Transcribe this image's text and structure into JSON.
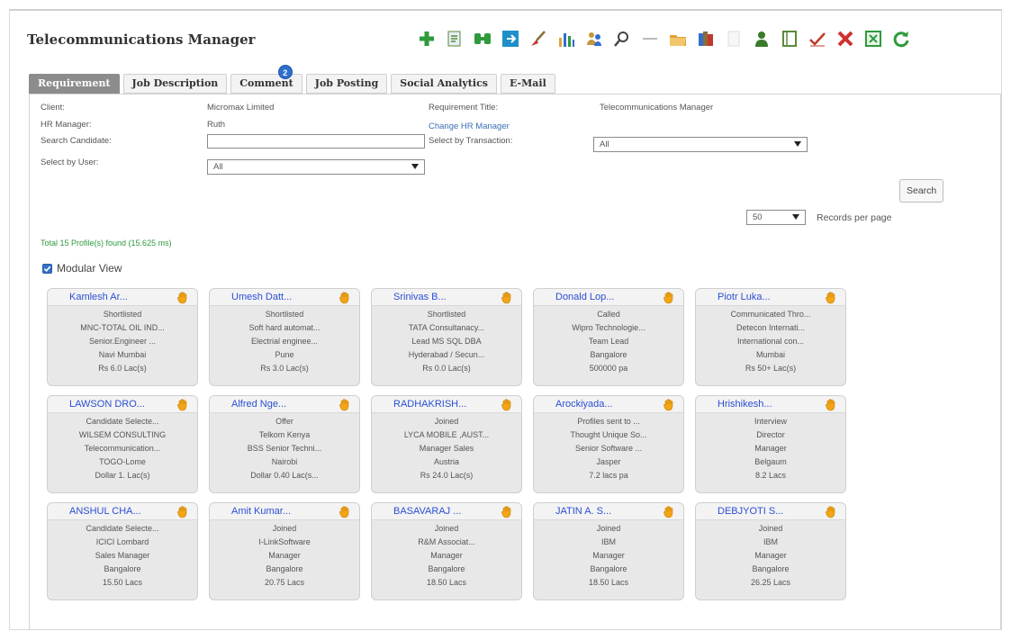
{
  "window": {
    "title": "Telecommunications Manager"
  },
  "toolbar": [
    {
      "icon": "add-icon",
      "color": "#2e9a3c"
    },
    {
      "icon": "document-icon",
      "color": "#5a8a3a"
    },
    {
      "icon": "binoculars-icon",
      "color": "#2e9a3c"
    },
    {
      "icon": "share-icon",
      "color": "#1f8fc9"
    },
    {
      "icon": "broom-icon",
      "color": "#c0392b"
    },
    {
      "icon": "bar-chart-icon",
      "color": "#2f6fd0"
    },
    {
      "icon": "people-icon",
      "color": "#c8953a"
    },
    {
      "icon": "magnify-icon",
      "color": "#444444"
    },
    {
      "icon": "minus-icon",
      "color": "#bbbbbb"
    },
    {
      "icon": "folder-icon",
      "color": "#e0a23a"
    },
    {
      "icon": "books-icon",
      "color": "#8a6d3b"
    },
    {
      "icon": "blank-doc-icon",
      "color": "#dddddd"
    },
    {
      "icon": "user-icon",
      "color": "#3a7a2a"
    },
    {
      "icon": "notebook-icon",
      "color": "#5a8a3a"
    },
    {
      "icon": "check-icon",
      "color": "#c0392b"
    },
    {
      "icon": "close-icon",
      "color": "#d0312d"
    },
    {
      "icon": "excel-icon",
      "color": "#2e9a3c"
    },
    {
      "icon": "refresh-icon",
      "color": "#2e9a3c"
    }
  ],
  "tabs": [
    {
      "label": "Requirement",
      "active": true
    },
    {
      "label": "Job Description"
    },
    {
      "label": "Comment",
      "badge": "2"
    },
    {
      "label": "Job Posting"
    },
    {
      "label": "Social Analytics"
    },
    {
      "label": "E-Mail"
    }
  ],
  "form": {
    "client_label": "Client:",
    "client_value": "Micromax Limited",
    "req_title_label": "Requirement Title:",
    "req_title_value": "Telecommunications Manager",
    "hr_label": "HR Manager:",
    "hr_value": "Ruth",
    "change_hr": "Change HR Manager",
    "search_label": "Search Candidate:",
    "search_value": "",
    "transaction_label": "Select by Transaction:",
    "transaction_value": "All",
    "user_label": "Select by User:",
    "user_value": "All",
    "search_button": "Search",
    "records_value": "50",
    "records_label": "Records per page"
  },
  "summary": {
    "total": "Total 15 Profile(s) found (15.625 ms)"
  },
  "view": {
    "modular_label": "Modular View",
    "modular_checked": true
  },
  "cards": [
    {
      "name": "Kamlesh Ar...",
      "lines": [
        "Shortlisted",
        "MNC-TOTAL OIL IND...",
        "Senior.Engineer ...",
        "Navi Mumbai",
        "Rs 6.0 Lac(s)"
      ]
    },
    {
      "name": "Umesh Datt...",
      "lines": [
        "Shortlisted",
        "Soft hard automat...",
        "Electrial enginee...",
        "Pune",
        "Rs 3.0 Lac(s)"
      ]
    },
    {
      "name": "Srinivas B...",
      "lines": [
        "Shortlisted",
        "TATA Consultanacy...",
        "Lead MS SQL DBA",
        "Hyderabad / Secun...",
        "Rs 0.0 Lac(s)"
      ]
    },
    {
      "name": "Donald Lop...",
      "lines": [
        "Called",
        "Wipro Technologie...",
        "Team Lead",
        "Bangalore",
        "500000 pa"
      ]
    },
    {
      "name": "Piotr Luka...",
      "lines": [
        "Communicated Thro...",
        "Detecon Internati...",
        "International con...",
        "Mumbai",
        "Rs 50+ Lac(s)"
      ]
    },
    {
      "name": "LAWSON DRO...",
      "lines": [
        "Candidate Selecte...",
        "WILSEM CONSULTING",
        "Telecommunication...",
        "TOGO-Lome",
        "Dollar 1. Lac(s)"
      ]
    },
    {
      "name": "Alfred Nge...",
      "lines": [
        "Offer",
        "Telkom Kenya",
        "BSS Senior Techni...",
        "Nairobi",
        "Dollar 0.40 Lac(s..."
      ]
    },
    {
      "name": "RADHAKRISH...",
      "lines": [
        "Joined",
        "LYCA MOBILE ,AUST...",
        "Manager Sales",
        "Austria",
        "Rs 24.0 Lac(s)"
      ]
    },
    {
      "name": "Arockiyada...",
      "lines": [
        "Profiles sent to ...",
        "Thought Unique So...",
        "Senior Software ...",
        "Jasper",
        "7.2 lacs pa"
      ]
    },
    {
      "name": "Hrishikesh...",
      "lines": [
        "Interview",
        "Director",
        "Manager",
        "Belgaum",
        "8.2 Lacs"
      ]
    },
    {
      "name": "ANSHUL CHA...",
      "lines": [
        "Candidate Selecte...",
        "ICICI Lombard",
        "Sales Manager",
        "Bangalore",
        "15.50 Lacs"
      ]
    },
    {
      "name": "Amit Kumar...",
      "lines": [
        "Joined",
        "I-LinkSoftware",
        "Manager",
        "Bangalore",
        "20.75 Lacs"
      ]
    },
    {
      "name": "BASAVARAJ ...",
      "lines": [
        "Joined",
        "R&M Associat...",
        "Manager",
        "Bangalore",
        "18.50 Lacs"
      ]
    },
    {
      "name": "JATIN A. S...",
      "lines": [
        "Joined",
        "IBM",
        "Manager",
        "Bangalore",
        "18.50 Lacs"
      ]
    },
    {
      "name": "DEBJYOTI S...",
      "lines": [
        "Joined",
        "IBM",
        "Manager",
        "Bangalore",
        "26.25 Lacs"
      ]
    }
  ]
}
